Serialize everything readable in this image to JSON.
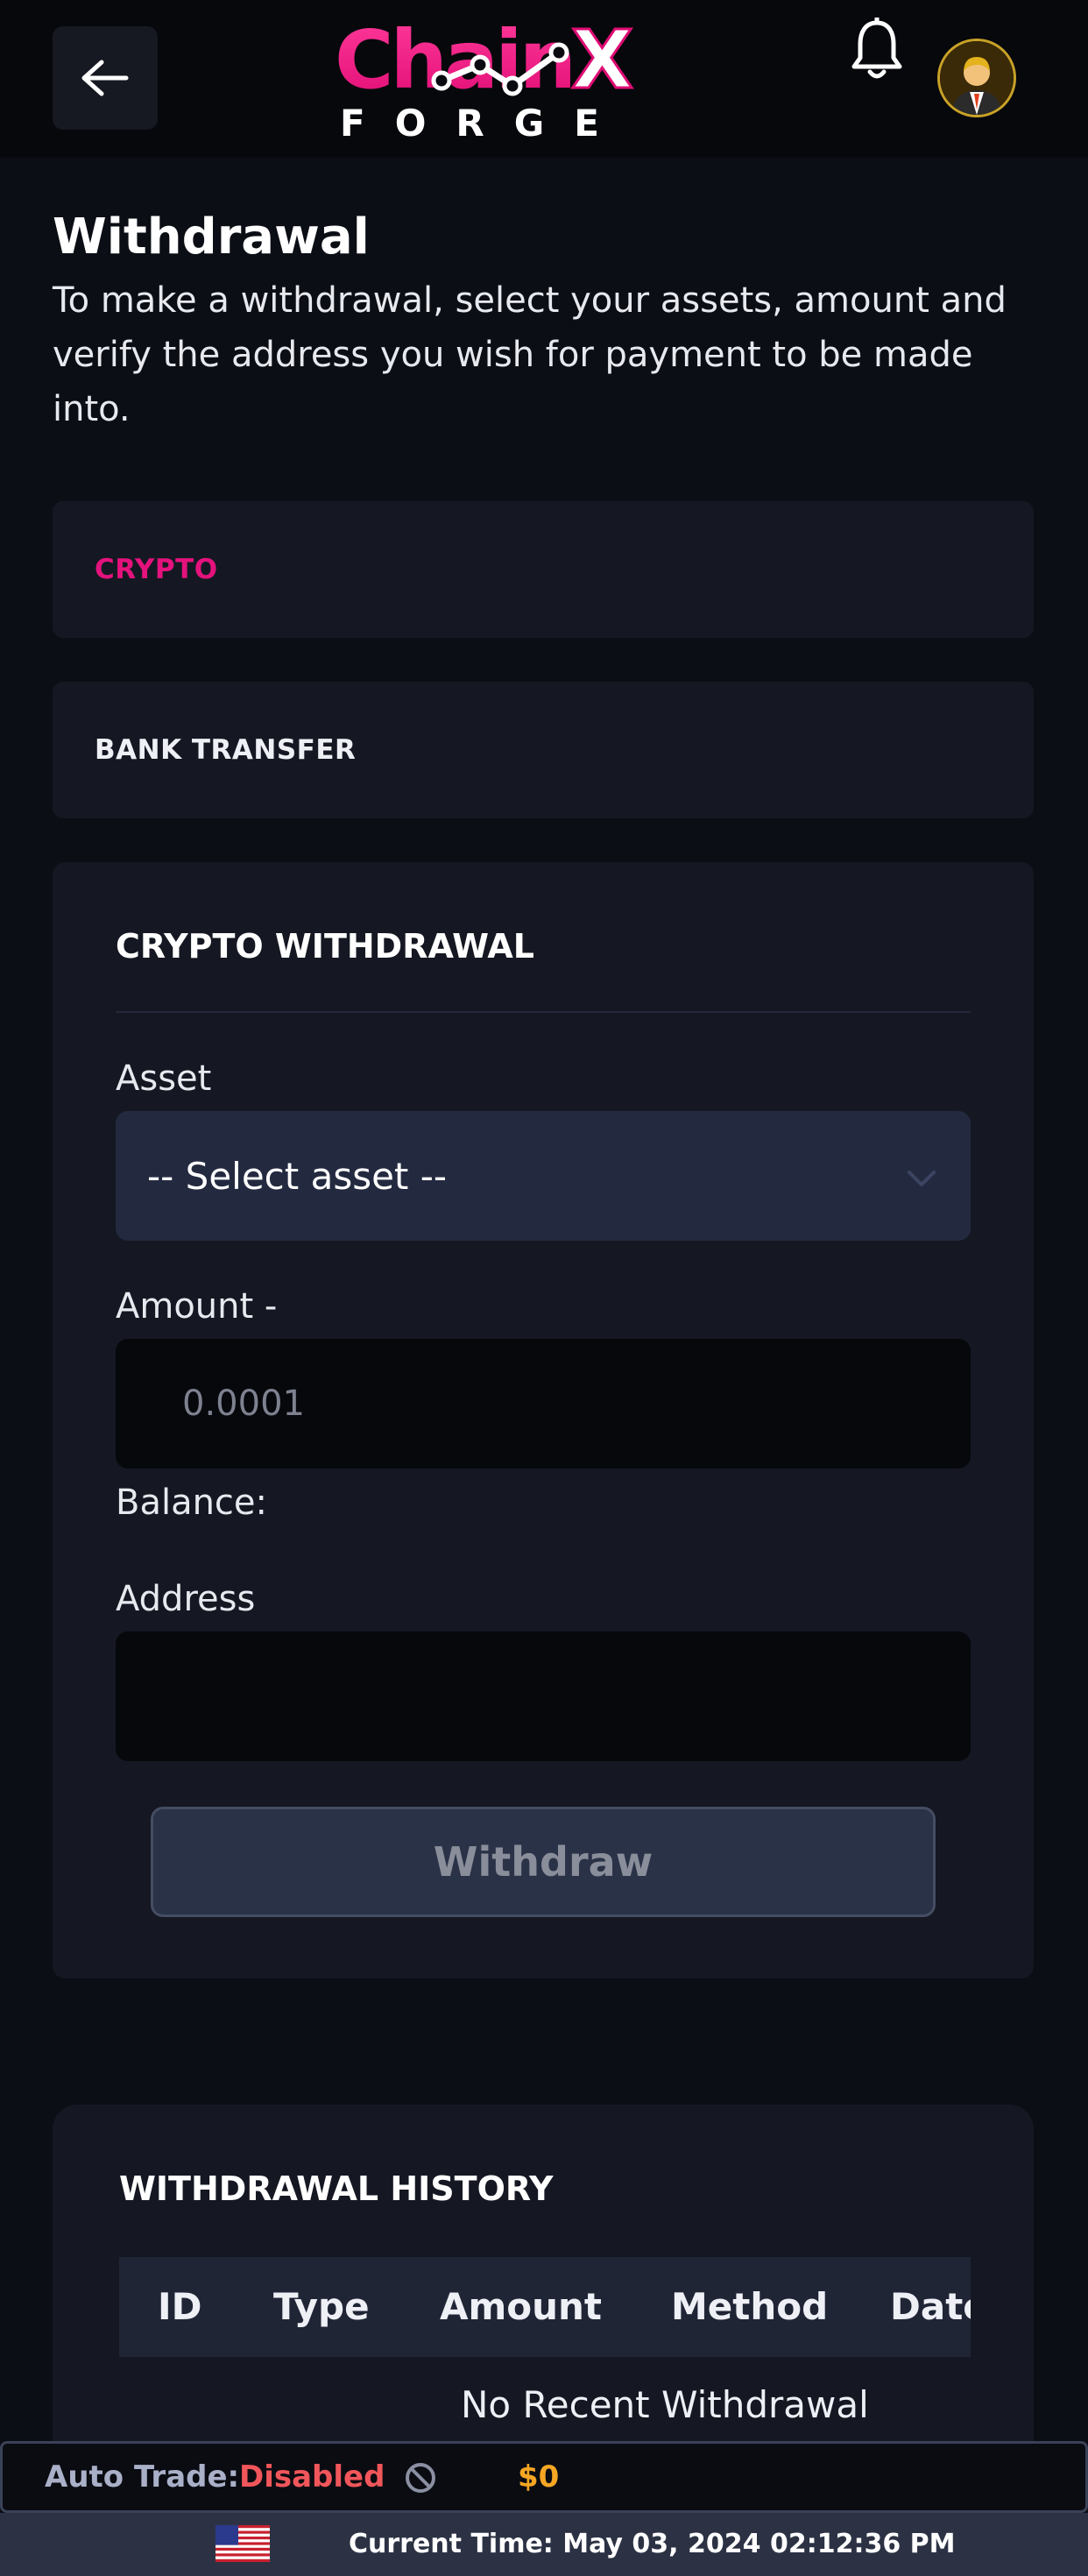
{
  "header": {
    "back_icon": "arrow-left-icon",
    "logo_text_main": "Chain",
    "logo_text_x": "X",
    "logo_text_sub": "FORGE",
    "bell_icon": "bell-icon",
    "avatar_icon": "user-avatar-icon"
  },
  "page": {
    "title": "Withdrawal",
    "description": "To make a withdrawal, select your assets, amount and verify the address you wish for payment to be made into."
  },
  "tabs": [
    {
      "label": "CRYPTO",
      "active": true
    },
    {
      "label": "BANK TRANSFER",
      "active": false
    }
  ],
  "crypto_withdrawal": {
    "title": "CRYPTO WITHDRAWAL",
    "asset_label": "Asset",
    "asset_selected": "-- Select asset --",
    "amount_label": "Amount -",
    "amount_placeholder": "0.0001",
    "amount_value": "",
    "balance_label": "Balance:",
    "address_label": "Address",
    "address_value": "",
    "submit_label": "Withdraw"
  },
  "withdrawal_history": {
    "title": "WITHDRAWAL HISTORY",
    "columns": [
      "ID",
      "Type",
      "Amount",
      "Method",
      "Date"
    ],
    "empty_message": "No Recent Withdrawal"
  },
  "status_bar": {
    "auto_trade_label": "Auto Trade:",
    "auto_trade_status": "Disabled",
    "status_icon": "disabled-circle-icon",
    "balance": "$0"
  },
  "time_bar": {
    "flag_icon": "us-flag-icon",
    "current_time": "Current Time: May 03, 2024 02:12:36 PM"
  },
  "colors": {
    "background": "#0c0e15",
    "accent_pink": "#e4127d",
    "disabled_red": "#f0565a",
    "balance_orange": "#f5a623",
    "card": "#151822",
    "input": "#232a40"
  }
}
